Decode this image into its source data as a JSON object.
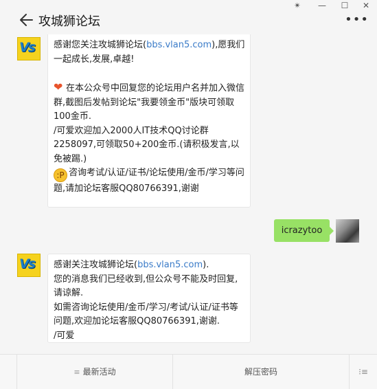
{
  "window": {
    "pin": "✴",
    "minimize": "—",
    "maximize": "☐",
    "close": "✕"
  },
  "header": {
    "title": "攻城狮论坛",
    "more": "•••"
  },
  "avatar": {
    "brand_text": "Vs"
  },
  "messages": {
    "m1_p1_pre": "感谢您关注攻城狮论坛(",
    "m1_p1_link": "bbs.vlan5.com",
    "m1_p1_post": "),愿我们一起成长,发展,卓越!",
    "m1_p2": "在本公众号中回复您的论坛用户名并加入微信群,截图后发帖到论坛\"我要领金币\"版块可领取100金币.",
    "m1_p3": "/可爱欢迎加入2000人IT技术QQ讨论群2258097,可领取50+200金币.(请积极发言,以免被踢.)",
    "m1_p4": "咨询考试/认证/证书/论坛使用/金币/学习等问题,请加论坛客服QQ80766391,谢谢",
    "user_text": "icrazytoo",
    "m3_pre": "感谢关注攻城狮论坛(",
    "m3_link": "bbs.vlan5.com",
    "m3_post": ").\n您的消息我们已经收到,但公众号不能及时回复,请谅解.\n如需咨询论坛使用/金币/学习/考试/认证/证书等问题,欢迎加论坛客服QQ80766391,谢谢.\n/可爱"
  },
  "bottom_menu": {
    "item1": "最新活动",
    "item2": "解压密码"
  }
}
